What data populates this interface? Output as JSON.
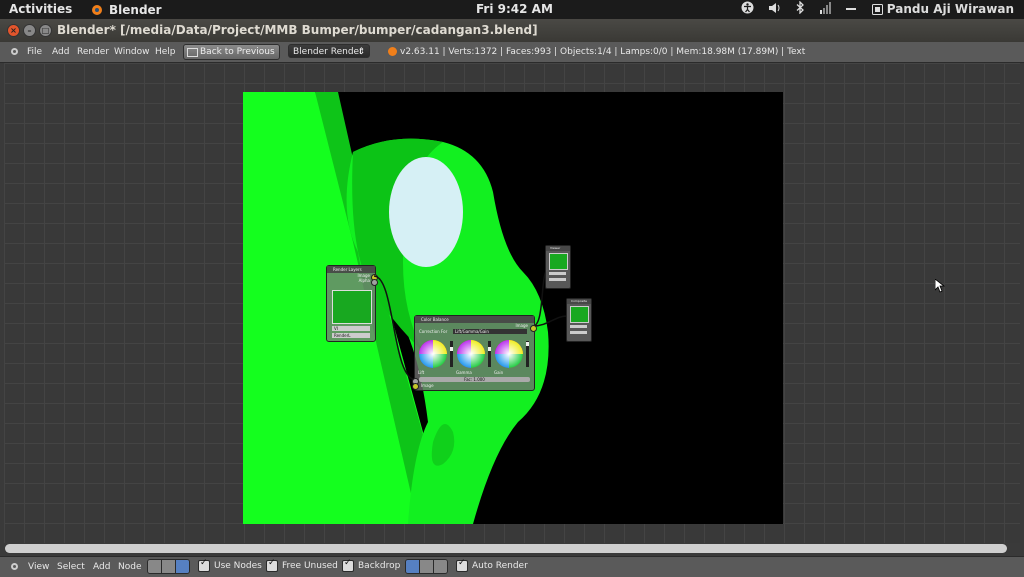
{
  "topbar": {
    "activities": "Activities",
    "app_name": "Blender",
    "clock": "Fri  9:42 AM",
    "user": "Pandu Aji Wirawan"
  },
  "window": {
    "title": "Blender* [/media/Data/Project/MMB Bumper/bumper/cadangan3.blend]"
  },
  "menubar": {
    "items": [
      "File",
      "Add",
      "Render",
      "Window",
      "Help"
    ],
    "back_button": "Back to Previous",
    "render_engine": "Blender Render",
    "stats": "v2.63.11 | Verts:1372 | Faces:993 | Objects:1/4 | Lamps:0/0 | Mem:18.98M (17.89M) | Text"
  },
  "nodes": {
    "render_layers": {
      "title": "Render Layers",
      "outputs": [
        "Image",
        "Alpha"
      ],
      "layer": "VI",
      "scene": "RenderL"
    },
    "color_balance": {
      "title": "Color Balance",
      "output": "Image",
      "correction_label": "Correction For",
      "method": "Lift/Gamma/Gain",
      "wheels": [
        "Lift",
        "Gamma",
        "Gain"
      ],
      "fac": "Fac: 1.000",
      "input": "Image"
    },
    "viewer": {
      "title": "Viewer"
    },
    "composite": {
      "title": "Composite"
    }
  },
  "footer": {
    "menus": [
      "View",
      "Select",
      "Add",
      "Node"
    ],
    "use_nodes": "Use Nodes",
    "free_unused": "Free Unused",
    "backdrop": "Backdrop",
    "auto_render": "Auto Render"
  },
  "colors": {
    "accent": "#f07f1a",
    "viewport_green": "#11ff22",
    "background": "#393939"
  }
}
